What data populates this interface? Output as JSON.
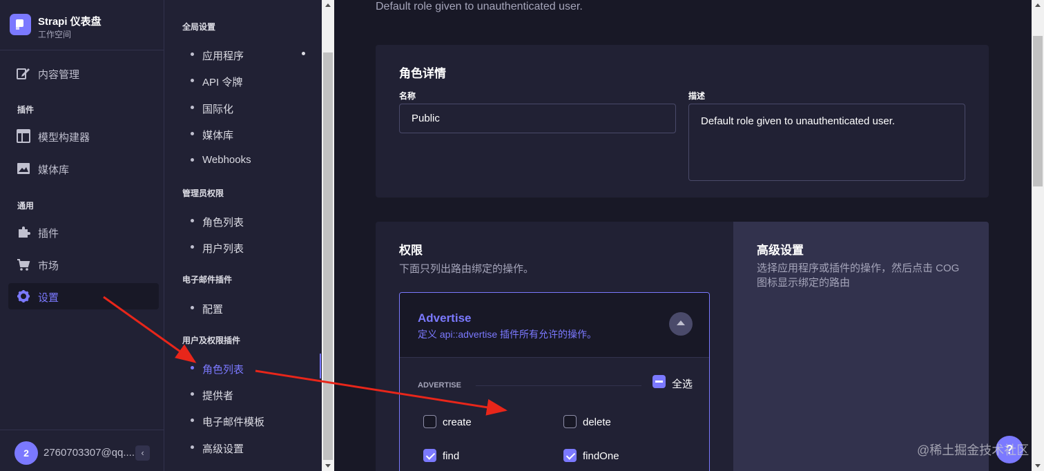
{
  "brand": {
    "title": "Strapi 仪表盘",
    "subtitle": "工作空间"
  },
  "mainnav": {
    "content_manager": "内容管理",
    "plugins_section": "插件",
    "builder": "模型构建器",
    "media": "媒体库",
    "general_section": "通用",
    "plugins": "插件",
    "marketplace": "市场",
    "settings": "设置"
  },
  "user": {
    "initial": "2",
    "email": "2760703307@qq...."
  },
  "subnav": {
    "global_section": "全局设置",
    "global_items": [
      "应用程序",
      "API 令牌",
      "国际化",
      "媒体库",
      "Webhooks"
    ],
    "admin_section": "管理员权限",
    "admin_items": [
      "角色列表",
      "用户列表"
    ],
    "email_section": "电子邮件插件",
    "email_items": [
      "配置"
    ],
    "up_section": "用户及权限插件",
    "up_items": [
      "角色列表",
      "提供者",
      "电子邮件模板",
      "高级设置"
    ]
  },
  "page": {
    "top_description": "Default role given to unauthenticated user."
  },
  "role_details": {
    "title": "角色详情",
    "name_label": "名称",
    "name_value": "Public",
    "desc_label": "描述",
    "desc_value": "Default role given to unauthenticated user."
  },
  "permissions": {
    "title": "权限",
    "subtitle": "下面只列出路由绑定的操作。",
    "advanced_title": "高级设置",
    "advanced_desc": "选择应用程序或插件的操作，然后点击 COG 图标显示绑定的路由",
    "accordion": {
      "title": "Advertise",
      "description": "定义 api::advertise 插件所有允许的操作。",
      "group_label": "ADVERTISE",
      "select_all": "全选",
      "actions": [
        {
          "label": "create",
          "checked": false
        },
        {
          "label": "delete",
          "checked": false
        },
        {
          "label": "find",
          "checked": true
        },
        {
          "label": "findOne",
          "checked": true
        }
      ]
    }
  },
  "help": {
    "label": "?"
  },
  "watermark": "@稀土掘金技术社区",
  "colors": {
    "accent": "#7b79ff",
    "arrow": "#e8261a",
    "background": "#181826",
    "panel": "#212134"
  }
}
